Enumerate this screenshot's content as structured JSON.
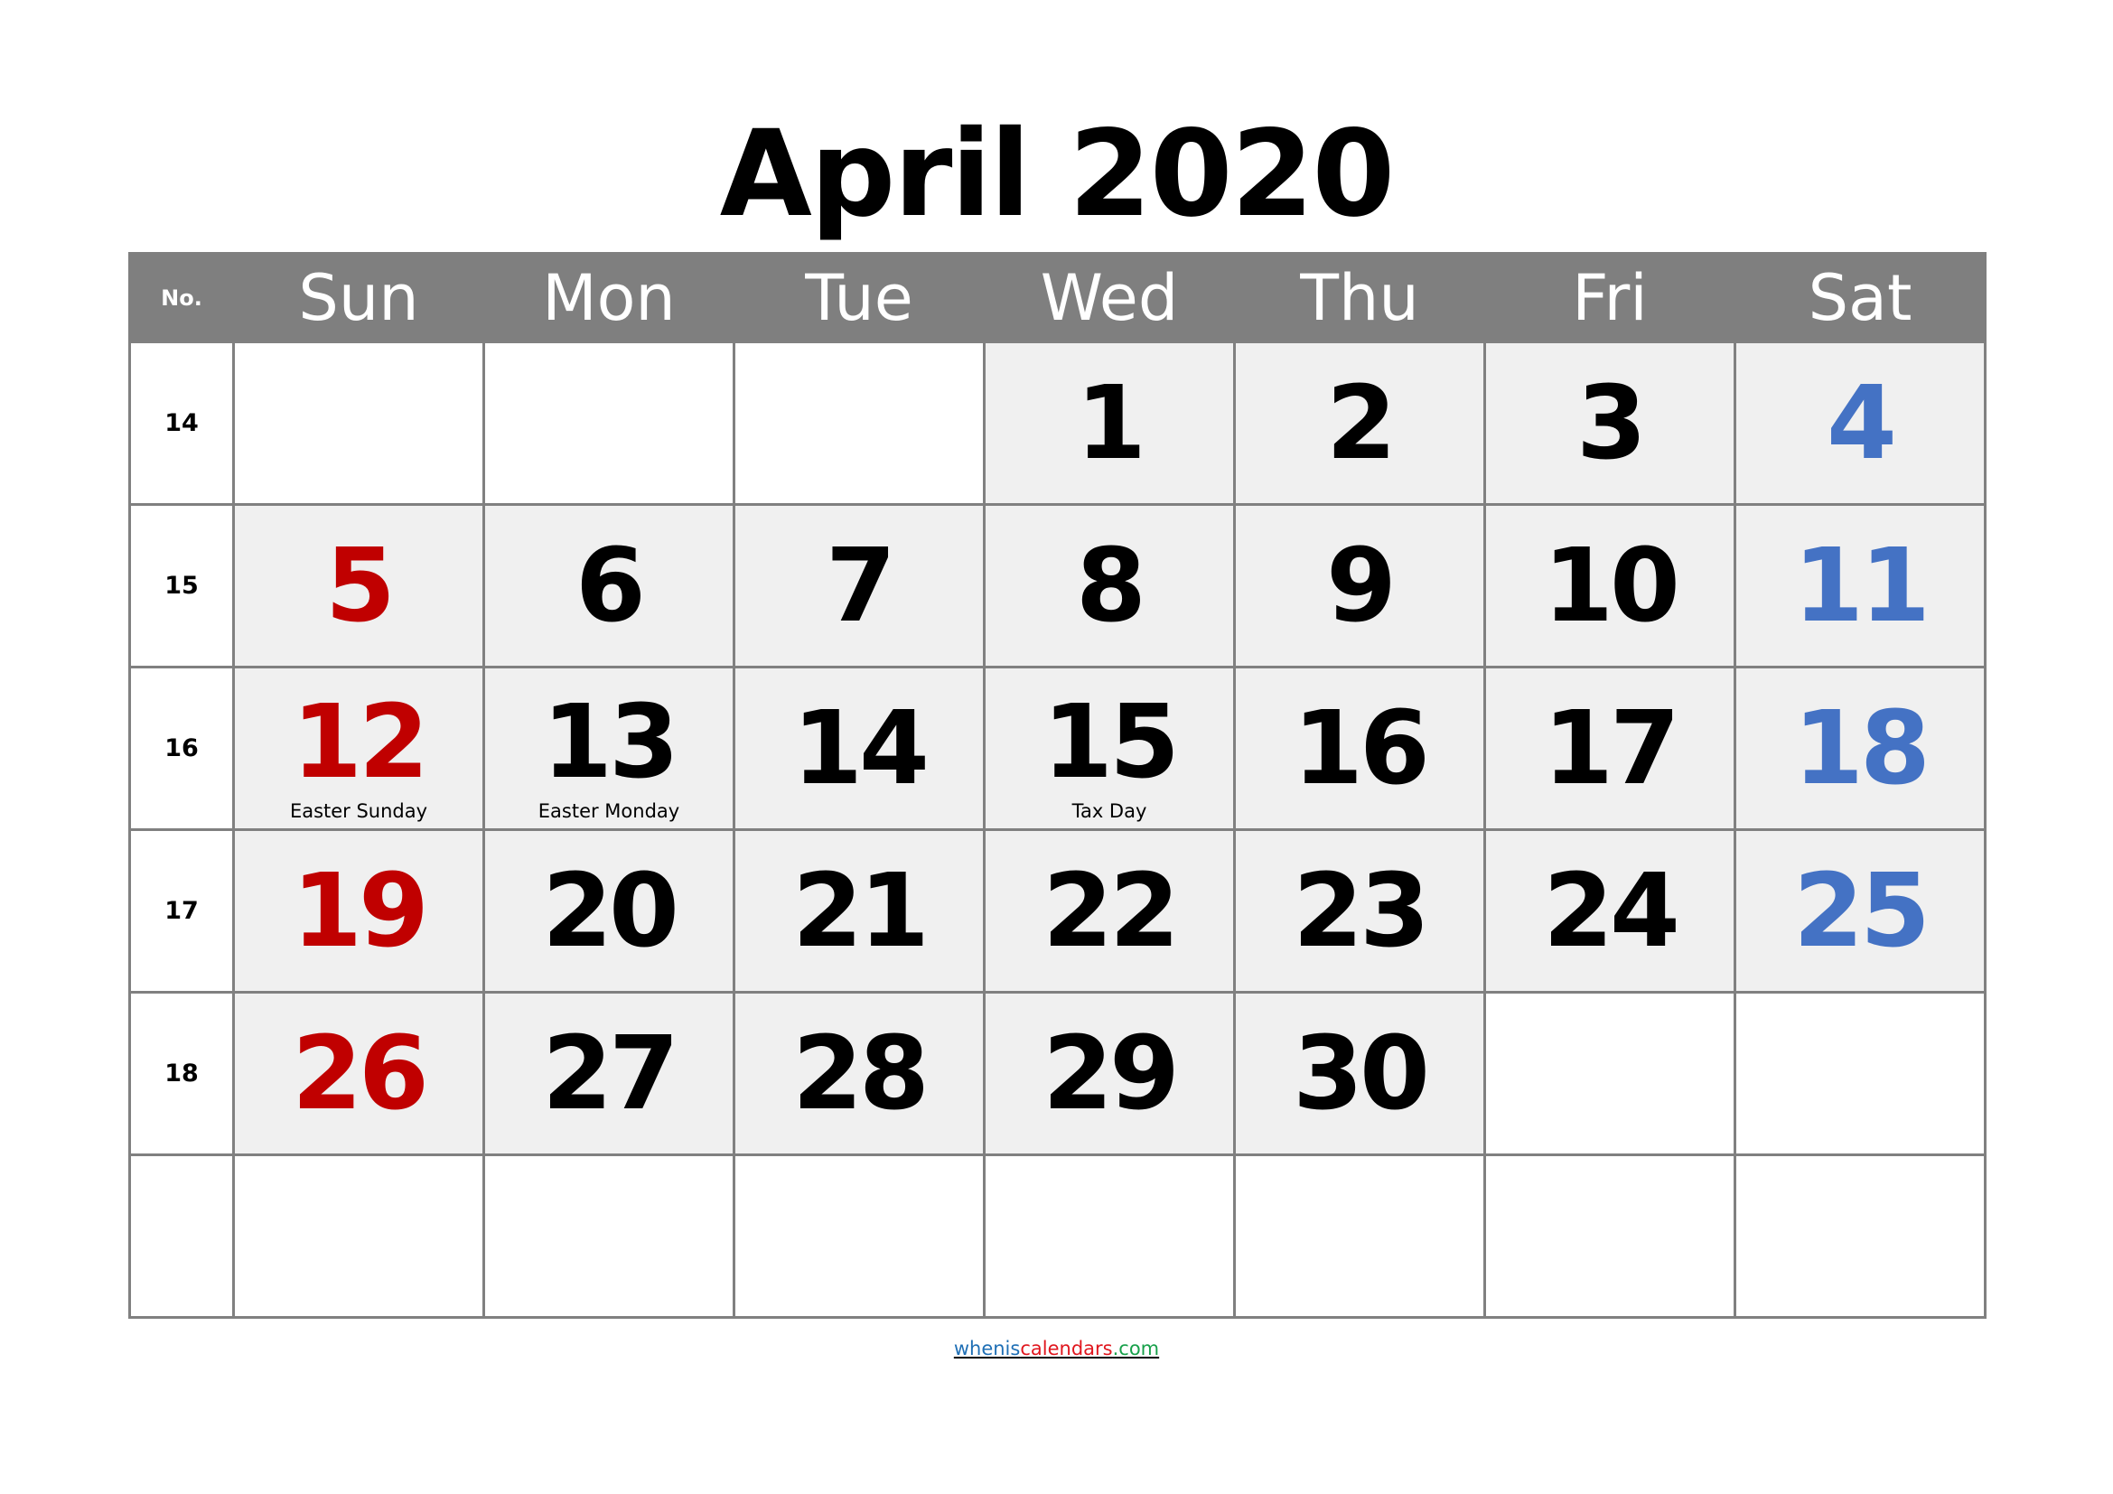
{
  "title": "April 2020",
  "header": {
    "week_no_label": "No.",
    "days": [
      "Sun",
      "Mon",
      "Tue",
      "Wed",
      "Thu",
      "Fri",
      "Sat"
    ]
  },
  "colors": {
    "header_bg": "#7F7F7F",
    "border": "#808080",
    "filled_cell_bg": "#F0F0F0",
    "sunday": "#C00000",
    "saturday": "#4472C4",
    "weekday": "#000000"
  },
  "weeks": [
    {
      "no": "14",
      "days": [
        "",
        "",
        "",
        "1",
        "2",
        "3",
        "4"
      ]
    },
    {
      "no": "15",
      "days": [
        "5",
        "6",
        "7",
        "8",
        "9",
        "10",
        "11"
      ]
    },
    {
      "no": "16",
      "days": [
        "12",
        "13",
        "14",
        "15",
        "16",
        "17",
        "18"
      ]
    },
    {
      "no": "17",
      "days": [
        "19",
        "20",
        "21",
        "22",
        "23",
        "24",
        "25"
      ]
    },
    {
      "no": "18",
      "days": [
        "26",
        "27",
        "28",
        "29",
        "30",
        "",
        ""
      ]
    },
    {
      "no": "",
      "days": [
        "",
        "",
        "",
        "",
        "",
        "",
        ""
      ]
    }
  ],
  "holidays": {
    "12": "Easter Sunday",
    "13": "Easter Monday",
    "15": "Tax Day"
  },
  "footer": {
    "part1": "whenis",
    "part2": "calendars",
    "part3": ".com"
  }
}
